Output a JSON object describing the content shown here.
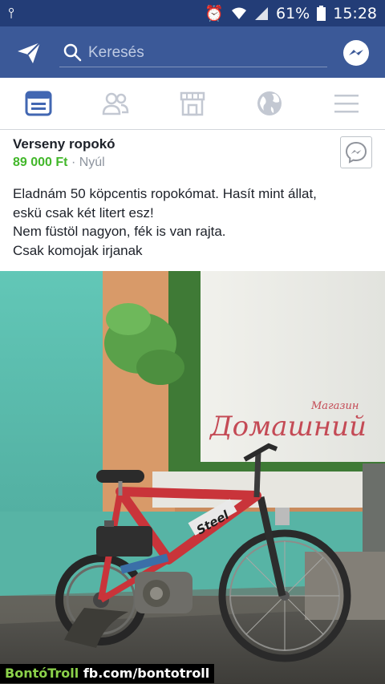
{
  "status_bar": {
    "battery_percent": "61%",
    "time": "15:28",
    "icons": [
      "usb-icon",
      "alarm-icon",
      "wifi-icon",
      "signal-icon",
      "battery-icon"
    ]
  },
  "top_bar": {
    "search_placeholder": "Keresés",
    "icons": [
      "send-icon",
      "search-icon",
      "messenger-icon"
    ]
  },
  "tab_bar": {
    "tabs": [
      "news-feed-icon",
      "friends-icon",
      "marketplace-icon",
      "globe-icon",
      "menu-icon"
    ],
    "active_tab": "news-feed-icon",
    "active_color": "#4267b2",
    "inactive_color": "#c3c8d2"
  },
  "post": {
    "title": "Verseny ropokó",
    "price": "89 000 Ft",
    "separator": "·",
    "location": "Nyúl",
    "description": [
      "Eladnám 50 köpcentis ropokómat. Hasít mint állat,",
      "eskü csak két litert esz!",
      "Nem füstöl nagyon, fék is van rajta.",
      "Csak komojak irjanak"
    ]
  },
  "photo": {
    "sign_small_text": "Магазин",
    "sign_text": "Домашний",
    "frame_text": "Steel"
  },
  "watermark": {
    "brand": "BontóTroll",
    "url": "fb.com/bontotroll"
  },
  "colors": {
    "status_bar": "#233d77",
    "header": "#3b5998",
    "price": "#42b72a",
    "bike_frame": "#c9343a",
    "wall": "#5fc0b0"
  }
}
